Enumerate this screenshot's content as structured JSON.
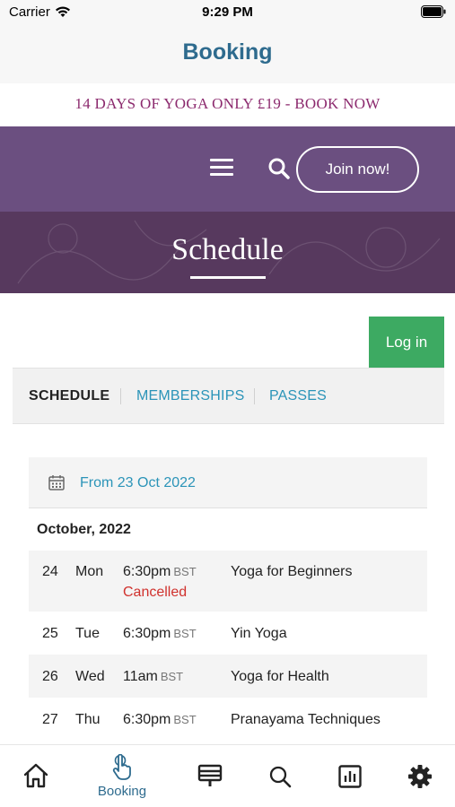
{
  "status_bar": {
    "carrier": "Carrier",
    "time": "9:29 PM"
  },
  "app": {
    "title": "Booking"
  },
  "promo": {
    "text": "14 DAYS OF YOGA ONLY £19 - BOOK NOW"
  },
  "nav": {
    "join_label": "Join now!"
  },
  "hero": {
    "title": "Schedule"
  },
  "login": {
    "label": "Log in"
  },
  "tabs": [
    {
      "label": "SCHEDULE",
      "active": true
    },
    {
      "label": "MEMBERSHIPS",
      "active": false
    },
    {
      "label": "PASSES",
      "active": false
    }
  ],
  "date_filter": {
    "label": "From 23 Oct 2022"
  },
  "schedule": {
    "month": "October, 2022",
    "rows": [
      {
        "day": "24",
        "weekday": "Mon",
        "time": "6:30pm",
        "tz": "BST",
        "class": "Yoga for Beginners",
        "status": "Cancelled"
      },
      {
        "day": "25",
        "weekday": "Tue",
        "time": "6:30pm",
        "tz": "BST",
        "class": "Yin Yoga",
        "status": ""
      },
      {
        "day": "26",
        "weekday": "Wed",
        "time": "11am",
        "tz": "BST",
        "class": "Yoga for Health",
        "status": ""
      },
      {
        "day": "27",
        "weekday": "Thu",
        "time": "6:30pm",
        "tz": "BST",
        "class": "Pranayama Techniques",
        "status": ""
      }
    ]
  },
  "tabbar": {
    "active_label": "Booking",
    "items": [
      "home-icon",
      "tap-icon",
      "presentation-icon",
      "search-icon",
      "chart-icon",
      "gear-icon"
    ]
  },
  "colors": {
    "accent": "#2e6b8e",
    "promo": "#8c2a6e",
    "nav": "#6b4f80",
    "hero": "#57395e",
    "login": "#3daa62",
    "link": "#2b94b8",
    "cancelled": "#d0312d"
  }
}
